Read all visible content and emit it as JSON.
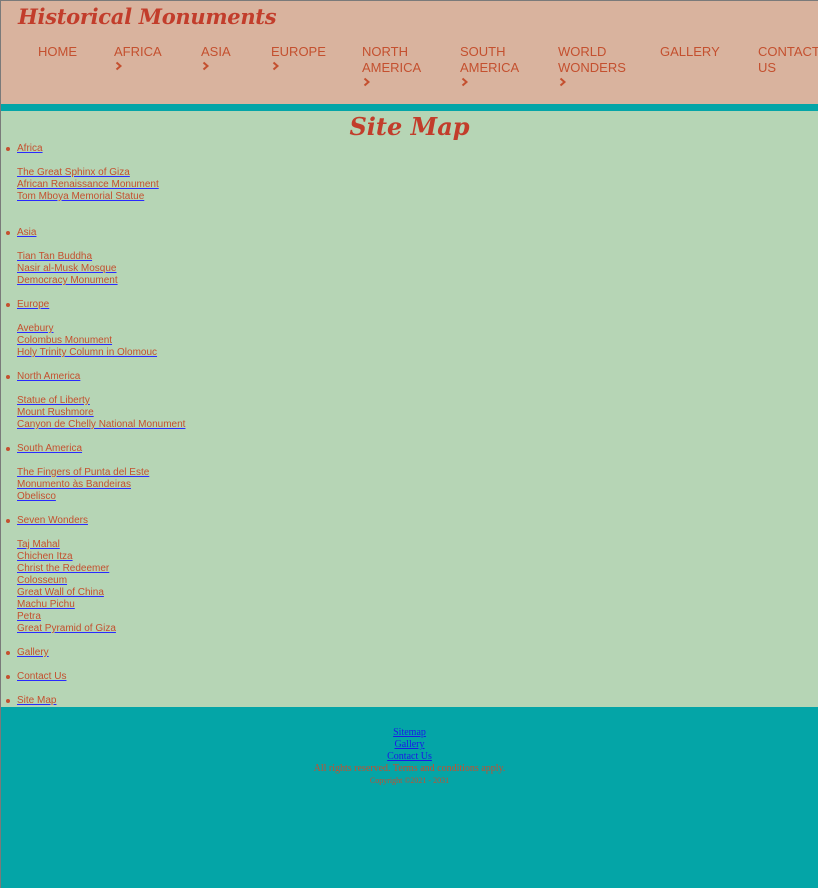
{
  "header": {
    "logo": "Historical Monuments",
    "nav": [
      {
        "label": "HOME",
        "line2": "",
        "has_chevron": false
      },
      {
        "label": "AFRICA",
        "line2": "",
        "has_chevron": true
      },
      {
        "label": "ASIA",
        "line2": "",
        "has_chevron": true
      },
      {
        "label": "EUROPE",
        "line2": "",
        "has_chevron": true
      },
      {
        "label": "NORTH",
        "line2": "AMERICA",
        "has_chevron": true
      },
      {
        "label": "SOUTH",
        "line2": "AMERICA",
        "has_chevron": true
      },
      {
        "label": "WORLD",
        "line2": "WONDERS",
        "has_chevron": true
      },
      {
        "label": "GALLERY",
        "line2": "",
        "has_chevron": false
      },
      {
        "label": "CONTACT",
        "line2": "US",
        "has_chevron": false
      }
    ]
  },
  "main": {
    "title": "Site Map",
    "sections": [
      {
        "label": "Africa",
        "links": [
          "The Great Sphinx of Giza",
          "African Renaissance Monument",
          "Tom Mboya Memorial Statue"
        ]
      },
      {
        "label": "Asia",
        "links": [
          "Tian Tan Buddha",
          "Nasir al-Musk Mosque",
          "Democracy Monument"
        ]
      },
      {
        "label": "Europe",
        "links": [
          "Avebury",
          "Colombus Monument",
          "Holy Trinity Column in Olomouc"
        ]
      },
      {
        "label": "North America",
        "links": [
          "Statue of Liberty",
          "Mount Rushmore",
          "Canyon de Chelly National Monument"
        ]
      },
      {
        "label": "South America",
        "links": [
          "The Fingers of Punta del Este",
          "Monumento às Bandeiras",
          "Obelisco"
        ]
      },
      {
        "label": "Seven Wonders",
        "links": [
          "Taj Mahal",
          "Chichen Itza",
          "Christ the Redeemer",
          "Colosseum",
          "Great Wall of China",
          "Machu Pichu",
          "Petra",
          "Great Pyramid of Giza"
        ]
      },
      {
        "label": "Gallery",
        "links": []
      },
      {
        "label": "Contact Us",
        "links": []
      },
      {
        "label": "Site Map",
        "links": []
      }
    ]
  },
  "footer": {
    "links": [
      "Sitemap",
      "Gallery",
      "Contact Us"
    ],
    "rights": "All rights reserved. Terms and conditions apply.",
    "copyright": "Copyright ©2021 - 2031"
  },
  "colors": {
    "header_bg": "#d9b39e",
    "accent": "#c4502f",
    "teal": "#04a5a7",
    "main_bg": "#b6d5b5"
  }
}
